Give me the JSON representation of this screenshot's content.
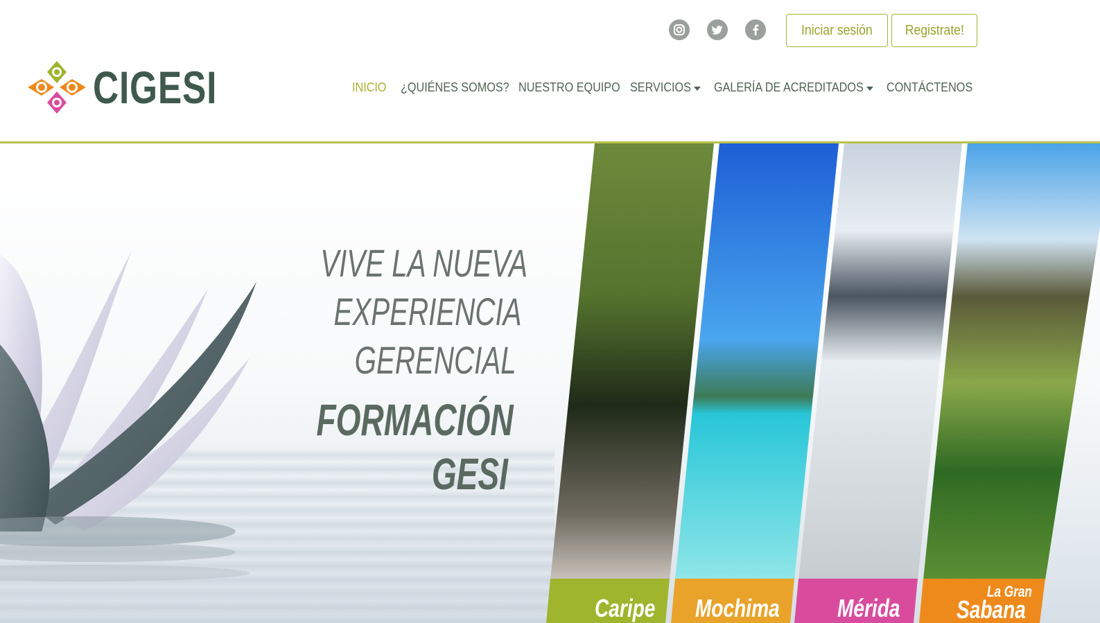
{
  "brand": {
    "name": "CIGESI"
  },
  "social": [
    {
      "name": "instagram-icon"
    },
    {
      "name": "twitter-icon"
    },
    {
      "name": "facebook-icon"
    }
  ],
  "auth": {
    "login": "Iniciar sesión",
    "register": "Registrate!"
  },
  "nav": [
    {
      "label": "INICIO"
    },
    {
      "label": "¿QUIÉNES SOMOS?"
    },
    {
      "label": "NUESTRO EQUIPO"
    },
    {
      "label": "SERVICIOS"
    },
    {
      "label": "GALERÍA DE ACREDITADOS"
    },
    {
      "label": "CONTÁCTENOS"
    }
  ],
  "hero": {
    "tagline": [
      "VIVE LA NUEVA",
      "EXPERIENCIA",
      "GERENCIAL"
    ],
    "headline": [
      "FORMACIÓN",
      "GESI"
    ],
    "places": [
      {
        "label": "Caripe",
        "color": "#9fb52e"
      },
      {
        "label": "Mochima",
        "color": "#e9a32a"
      },
      {
        "label": "Mérida",
        "color": "#d94c9d"
      },
      {
        "label_top": "La Gran",
        "label": "Sabana",
        "color": "#ee8a1c"
      }
    ]
  },
  "colors": {
    "accent": "#a8b231",
    "nav_text": "#4f6453",
    "brand_text": "#3f5a4c"
  }
}
